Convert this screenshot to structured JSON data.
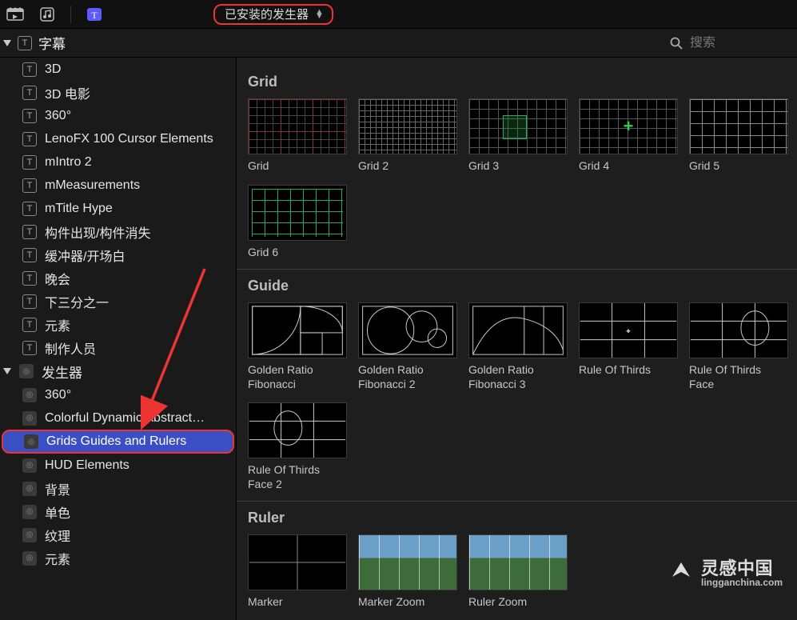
{
  "toolbar": {
    "dropdown_label": "已安装的发生器"
  },
  "search": {
    "placeholder": "搜索"
  },
  "sidebar": {
    "titles_header": "字幕",
    "title_items": [
      "3D",
      "3D 电影",
      "360°",
      "LenoFX 100 Cursor Elements",
      "mIntro 2",
      "mMeasurements",
      "mTitle Hype",
      "构件出现/构件消失",
      "缓冲器/开场白",
      "晚会",
      "下三分之一",
      "元素",
      "制作人员"
    ],
    "generators_header": "发生器",
    "generator_items": [
      "360°",
      "Colorful Dynamic Abstract…",
      "Grids Guides and Rulers",
      "HUD Elements",
      "背景",
      "单色",
      "纹理",
      "元素"
    ],
    "selected_generator_index": 2
  },
  "content": {
    "sections": [
      {
        "title": "Grid",
        "items": [
          "Grid",
          "Grid 2",
          "Grid 3",
          "Grid 4",
          "Grid 5",
          "Grid 6"
        ]
      },
      {
        "title": "Guide",
        "items": [
          "Golden Ratio Fibonacci",
          "Golden Ratio Fibonacci 2",
          "Golden Ratio Fibonacci 3",
          "Rule Of Thirds",
          "Rule Of Thirds Face",
          "Rule Of Thirds Face 2"
        ]
      },
      {
        "title": "Ruler",
        "items": [
          "Marker",
          "Marker Zoom",
          "Ruler Zoom"
        ]
      }
    ]
  },
  "watermark": {
    "main": "灵感中国",
    "sub": "lingganchina.com"
  }
}
